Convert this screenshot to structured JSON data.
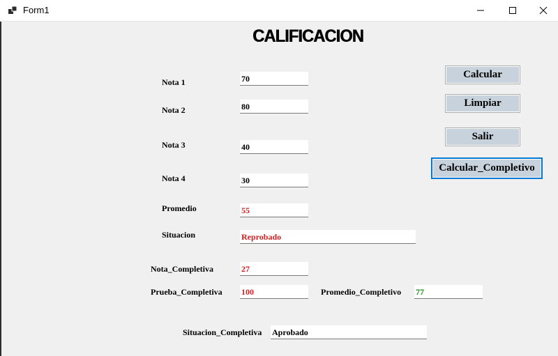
{
  "window": {
    "title": "Form1",
    "icons": {
      "app": "app-form-icon",
      "minimize": "minimize-icon",
      "maximize": "maximize-icon",
      "close": "close-icon"
    }
  },
  "form": {
    "heading": "CALIFICACION",
    "labels": {
      "nota1": "Nota 1",
      "nota2": "Nota 2",
      "nota3": "Nota 3",
      "nota4": "Nota 4",
      "promedio": "Promedio",
      "situacion": "Situacion",
      "nota_completiva": "Nota_Completiva",
      "prueba_completiva": "Prueba_Completiva",
      "promedio_completivo": "Promedio_Completivo",
      "situacion_completiva": "Situacion_Completiva"
    },
    "values": {
      "nota1": "70",
      "nota2": "80",
      "nota3": "40",
      "nota4": "30",
      "promedio": "55",
      "situacion": "Reprobado",
      "nota_completiva": "27",
      "prueba_completiva": "100",
      "promedio_completivo": "77",
      "situacion_completiva": "Aprobado"
    },
    "buttons": {
      "calcular": "Calcular",
      "limpiar": "Limpiar",
      "salir": "Salir",
      "calcular_completivo": "Calcular_Completivo"
    }
  },
  "colors": {
    "failing": "#d42020",
    "passing": "#1a8a1a",
    "button_face": "#c7d2dc",
    "focus_border": "#0078d7"
  }
}
